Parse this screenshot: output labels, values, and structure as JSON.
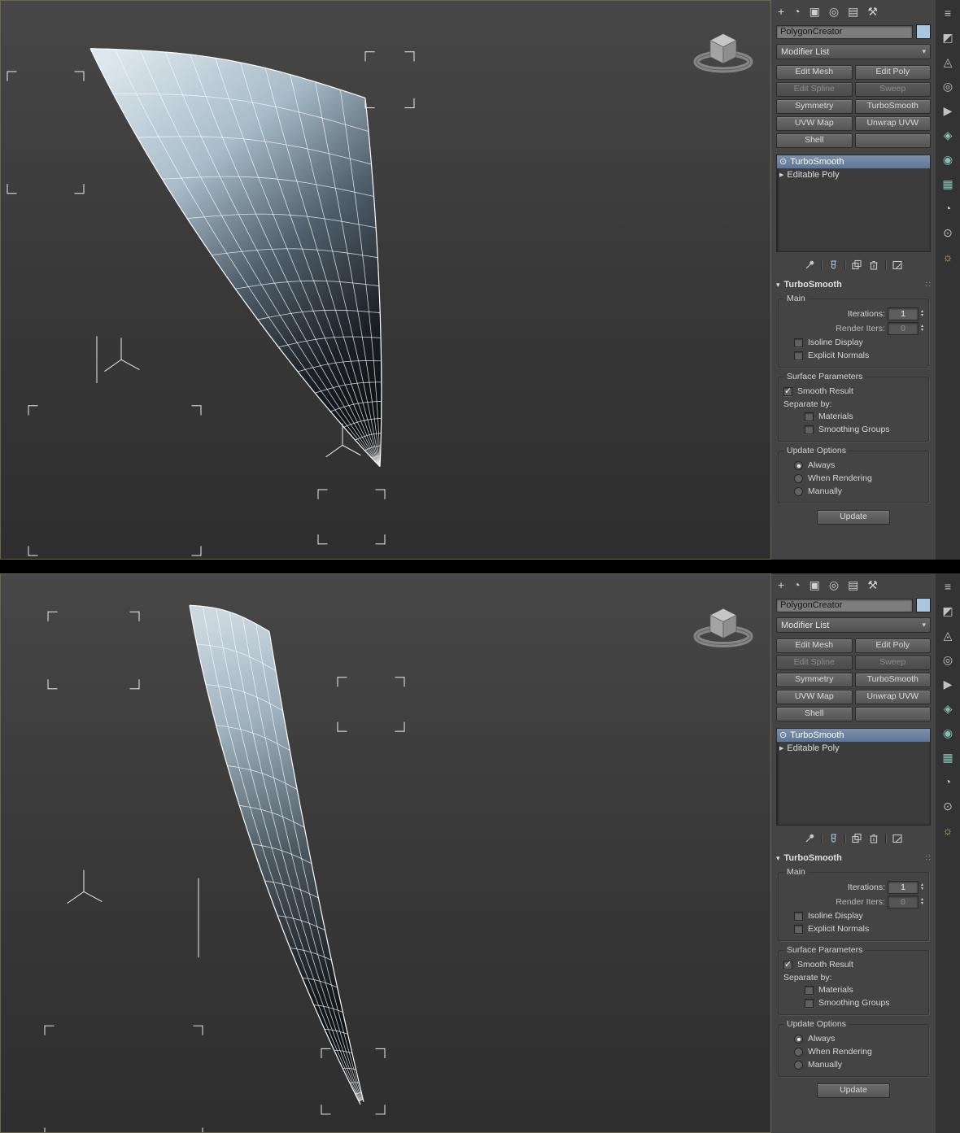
{
  "icons": {
    "dropdown_arrow": "▾",
    "spin_up": "▴",
    "spin_down": "▾",
    "eye": "⊙",
    "expand": "▶",
    "collapse": "▾",
    "grip": "∷"
  },
  "tabs": [
    {
      "name": "create",
      "glyph": "+"
    },
    {
      "name": "modify",
      "glyph": "◔"
    },
    {
      "name": "hierarchy",
      "glyph": "▣"
    },
    {
      "name": "motion",
      "glyph": "◎"
    },
    {
      "name": "display",
      "glyph": "▤"
    },
    {
      "name": "utilities",
      "glyph": "⚒"
    }
  ],
  "object_name": "PolygonCreator",
  "modifier_list_label": "Modifier List",
  "modifier_buttons": [
    {
      "label": "Edit Mesh",
      "enabled": true
    },
    {
      "label": "Edit Poly",
      "enabled": true
    },
    {
      "label": "Edit Spline",
      "enabled": false
    },
    {
      "label": "Sweep",
      "enabled": false
    },
    {
      "label": "Symmetry",
      "enabled": true
    },
    {
      "label": "TurboSmooth",
      "enabled": true
    },
    {
      "label": "UVW Map",
      "enabled": true
    },
    {
      "label": "Unwrap UVW",
      "enabled": true
    },
    {
      "label": "Shell",
      "enabled": true
    },
    {
      "label": "",
      "enabled": true
    }
  ],
  "stack": {
    "items": [
      {
        "label": "TurboSmooth",
        "selected": true
      },
      {
        "label": "Editable Poly",
        "selected": false
      }
    ]
  },
  "rollout": {
    "title": "TurboSmooth",
    "main_label": "Main",
    "iterations_label": "Iterations:",
    "iterations_value": "1",
    "render_iters_label": "Render Iters:",
    "render_iters_value": "0",
    "isoline_display_label": "Isoline Display",
    "explicit_normals_label": "Explicit Normals",
    "surface_parameters_label": "Surface Parameters",
    "smooth_result_label": "Smooth Result",
    "smooth_result_checked": true,
    "separate_by_label": "Separate by:",
    "materials_label": "Materials",
    "smoothing_groups_label": "Smoothing Groups",
    "update_options_label": "Update Options",
    "always_label": "Always",
    "when_rendering_label": "When Rendering",
    "manually_label": "Manually",
    "selected_update_option": "Always",
    "update_button": "Update"
  },
  "side_toolbar": {
    "icons": [
      {
        "name": "list-icon",
        "glyph": "≡"
      },
      {
        "name": "half-square-icon",
        "glyph": "◩"
      },
      {
        "name": "triangle-dot-icon",
        "glyph": "◬"
      },
      {
        "name": "circle-icon",
        "glyph": "◎"
      },
      {
        "name": "play-icon",
        "glyph": "▶"
      },
      {
        "name": "diamond-icon",
        "glyph": "◈"
      },
      {
        "name": "dot-circle-icon",
        "glyph": "◉"
      },
      {
        "name": "grid-icon",
        "glyph": "▦"
      },
      {
        "name": "quarter-circle-icon",
        "glyph": "◔"
      },
      {
        "name": "target-icon",
        "glyph": "⊙"
      },
      {
        "name": "sun-icon",
        "glyph": "☼"
      }
    ]
  }
}
